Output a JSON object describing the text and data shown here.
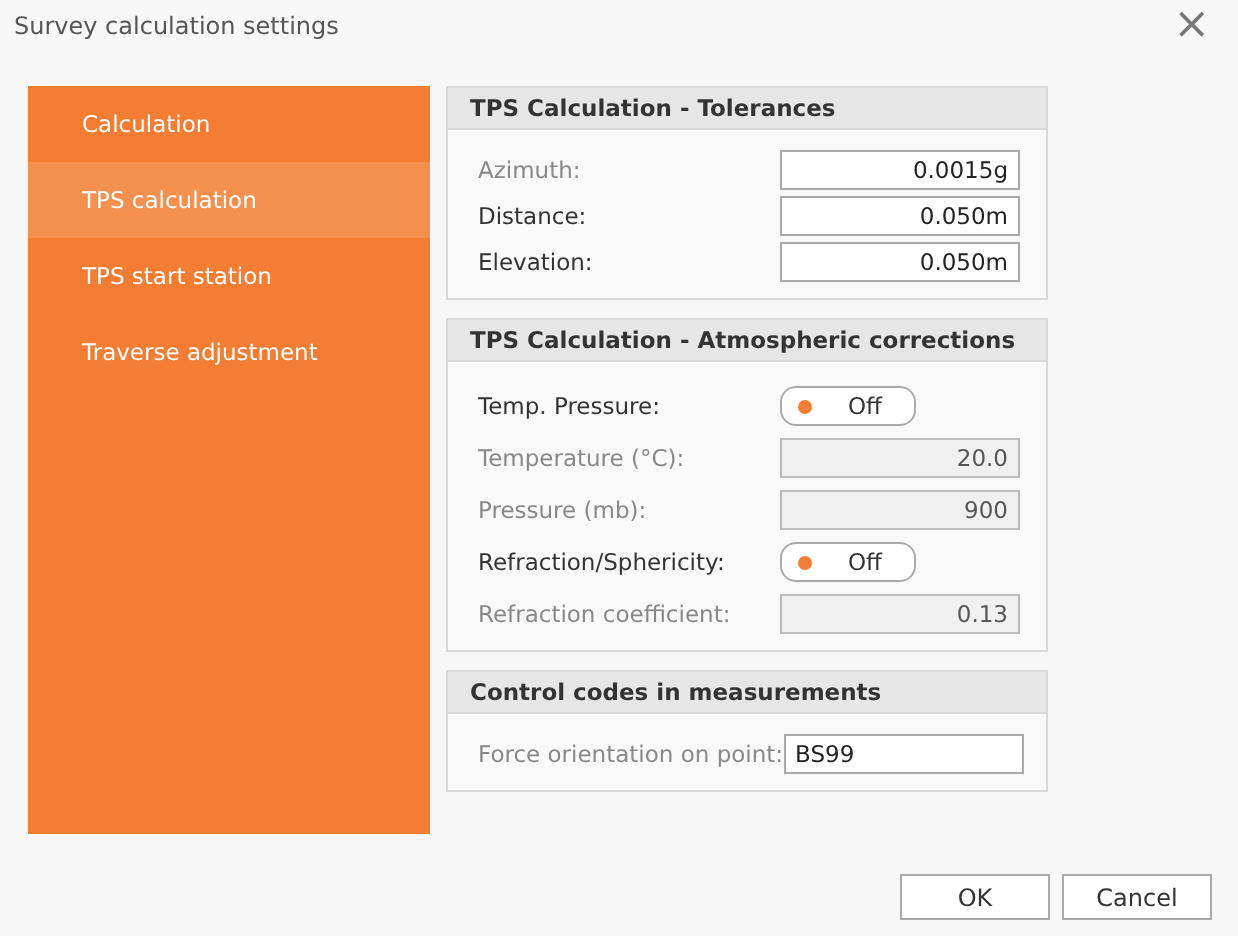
{
  "window": {
    "title": "Survey calculation settings",
    "close": "×"
  },
  "sidebar": {
    "items": [
      {
        "label": "Calculation",
        "selected": false
      },
      {
        "label": "TPS calculation",
        "selected": true
      },
      {
        "label": "TPS start station",
        "selected": false
      },
      {
        "label": "Traverse adjustment",
        "selected": false
      }
    ]
  },
  "sections": [
    {
      "title": "TPS Calculation - Tolerances",
      "rows": [
        {
          "kind": "number",
          "label": "Azimuth:",
          "value": "0.0015g",
          "disabled": false,
          "dimmed": true
        },
        {
          "kind": "number",
          "label": "Distance:",
          "value": "0.050m",
          "disabled": false,
          "dimmed": false
        },
        {
          "kind": "number",
          "label": "Elevation:",
          "value": "0.050m",
          "disabled": false,
          "dimmed": false
        }
      ]
    },
    {
      "title": "TPS Calculation - Atmospheric corrections",
      "rows": [
        {
          "kind": "toggle",
          "label": "Temp.  Pressure:",
          "text": "Off",
          "on": false
        },
        {
          "kind": "number",
          "label": "Temperature (°C):",
          "value": "20.0",
          "disabled": true,
          "dimmed": true
        },
        {
          "kind": "number",
          "label": "Pressure (mb):",
          "value": "900",
          "disabled": true,
          "dimmed": true
        },
        {
          "kind": "toggle",
          "label": "Refraction/Sphericity:",
          "text": "Off",
          "on": false
        },
        {
          "kind": "number",
          "label": "Refraction coefficient:",
          "value": "0.13",
          "disabled": true,
          "dimmed": true
        }
      ]
    },
    {
      "title": "Control codes in measurements",
      "rows": [
        {
          "kind": "text",
          "label": "Force orientation on point:",
          "value": "BS99",
          "disabled": false,
          "dimmed": true
        }
      ]
    }
  ],
  "buttons": [
    "OK",
    "Cancel"
  ]
}
